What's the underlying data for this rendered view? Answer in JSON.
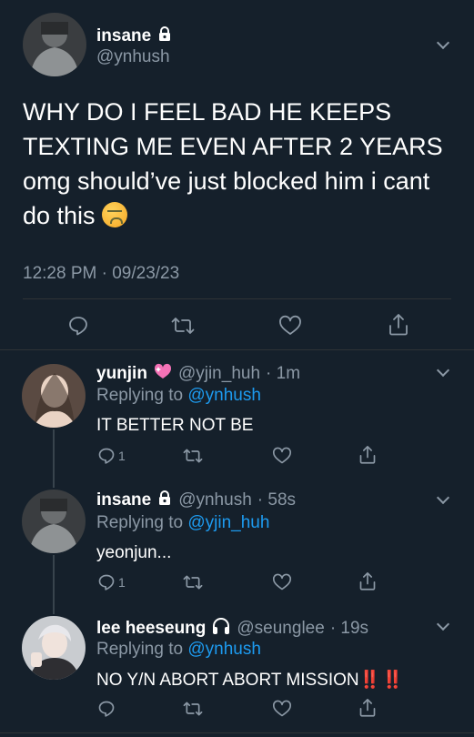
{
  "main_tweet": {
    "display_name": "insane",
    "handle": "@ynhush",
    "body": "WHY DO I FEEL BAD HE KEEPS TEXTING ME EVEN AFTER 2 YEARS omg should’ve just blocked him i cant do this",
    "emoji": "confounded-face-emoji",
    "timestamp": "12:28 PM · 09/23/23"
  },
  "replies": [
    {
      "display_name": "yunjin",
      "name_icon": "sparkling-heart-icon",
      "handle": "@yjin_huh",
      "time": "· 1m",
      "replying_prefix": "Replying to",
      "replying_to": "@ynhush",
      "text": "IT BETTER NOT BE",
      "reply_count": "1"
    },
    {
      "display_name": "insane",
      "name_icon": "lock-icon",
      "handle": "@ynhush",
      "time": "· 58s",
      "replying_prefix": "Replying to",
      "replying_to": "@yjin_huh",
      "text": "yeonjun...",
      "reply_count": "1"
    },
    {
      "display_name": "lee heeseung",
      "name_icon": "headphones-icon",
      "handle": "@seunglee",
      "time": "· 19s",
      "replying_prefix": "Replying to",
      "replying_to": "@ynhush",
      "text": "NO Y/N ABORT ABORT MISSION",
      "text_suffix": "‼️ ‼️",
      "reply_count": ""
    }
  ],
  "colors": {
    "background": "#15202b",
    "muted": "#8b98a5",
    "link": "#1d9bf0",
    "divider": "#2f3336"
  }
}
